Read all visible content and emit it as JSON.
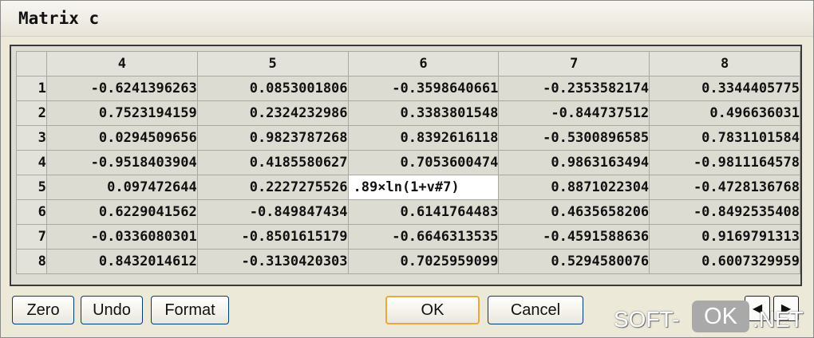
{
  "window": {
    "title": "Matrix c"
  },
  "grid": {
    "columns": [
      "4",
      "5",
      "6",
      "7",
      "8"
    ],
    "rows": [
      {
        "label": "1",
        "cells": [
          "-0.6241396263",
          "0.0853001806",
          "-0.3598640661",
          "-0.2353582174",
          "0.3344405775"
        ]
      },
      {
        "label": "2",
        "cells": [
          "0.7523194159",
          "0.2324232986",
          "0.3383801548",
          "-0.844737512",
          "0.496636031"
        ]
      },
      {
        "label": "3",
        "cells": [
          "0.0294509656",
          "0.9823787268",
          "0.8392616118",
          "-0.5300896585",
          "0.7831101584"
        ]
      },
      {
        "label": "4",
        "cells": [
          "-0.9518403904",
          "0.4185580627",
          "0.7053600474",
          "0.9863163494",
          "-0.9811164578"
        ]
      },
      {
        "label": "5",
        "cells": [
          "0.097472644",
          "0.2227275526",
          ".89×ln(1+v#7)",
          "0.8871022304",
          "-0.4728136768"
        ]
      },
      {
        "label": "6",
        "cells": [
          "0.6229041562",
          "-0.849847434",
          "0.6141764483",
          "0.4635658206",
          "-0.8492535408"
        ]
      },
      {
        "label": "7",
        "cells": [
          "-0.0336080301",
          "-0.8501615179",
          "-0.6646313535",
          "-0.4591588636",
          "0.9169791313"
        ]
      },
      {
        "label": "8",
        "cells": [
          "0.8432014612",
          "-0.3130420303",
          "0.7025959099",
          "0.5294580076",
          "0.6007329959"
        ]
      }
    ]
  },
  "buttons": {
    "zero": "Zero",
    "undo": "Undo",
    "format": "Format",
    "ok": "OK",
    "cancel": "Cancel"
  },
  "nav": {
    "left_icon": "arrow-left-icon",
    "right_icon": "arrow-right-icon"
  },
  "watermark": {
    "soft": "SOFT-",
    "ok": "OK",
    "net": ".NET"
  }
}
